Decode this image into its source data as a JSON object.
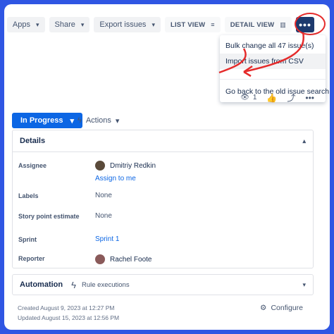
{
  "toolbar": {
    "apps": "Apps",
    "share": "Share",
    "export": "Export issues",
    "list_view": "LIST VIEW",
    "detail_view": "DETAIL VIEW",
    "more": "•••"
  },
  "menu": {
    "bulk": "Bulk change all 47 issue(s)",
    "import": "Import issues from CSV",
    "old_search": "Go back to the old issue search"
  },
  "iconrow": {
    "watchers": "1"
  },
  "status": {
    "label": "In Progress",
    "actions": "Actions"
  },
  "details": {
    "title": "Details",
    "fields": [
      {
        "label": "Assignee",
        "value": "Dmitriy Redkin",
        "link": "Assign to me"
      },
      {
        "label": "Labels",
        "value": "None"
      },
      {
        "label": "Story point estimate",
        "value": "None"
      },
      {
        "label": "Sprint",
        "value": "Sprint 1"
      },
      {
        "label": "Reporter",
        "value": "Rachel Foote"
      }
    ]
  },
  "automation": {
    "title": "Automation",
    "rule": "Rule executions"
  },
  "meta": {
    "created": "Created August 9, 2023 at 12:27 PM",
    "updated": "Updated August 15, 2023 at 12:56 PM",
    "configure": "Configure"
  },
  "colors": {
    "primary": "#0c66e4",
    "frame": "#2f56e3",
    "annotation": "#e52b2b",
    "more_button": "#1d3a6e"
  }
}
